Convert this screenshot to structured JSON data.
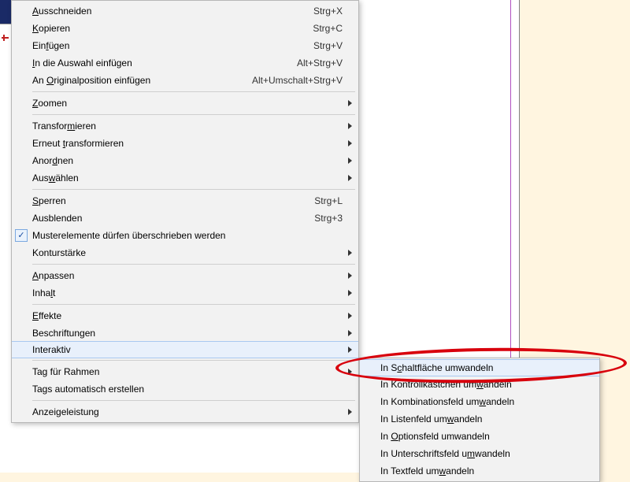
{
  "main_menu": [
    {
      "type": "item",
      "label": "Ausschneiden",
      "underline": 0,
      "shortcut": "Strg+X"
    },
    {
      "type": "item",
      "label": "Kopieren",
      "underline": 0,
      "shortcut": "Strg+C"
    },
    {
      "type": "item",
      "label": "Einfügen",
      "underline": 3,
      "shortcut": "Strg+V"
    },
    {
      "type": "item",
      "label": "In die Auswahl einfügen",
      "underline": 0,
      "shortcut": "Alt+Strg+V"
    },
    {
      "type": "item",
      "label": "An Originalposition einfügen",
      "underline": 3,
      "shortcut": "Alt+Umschalt+Strg+V"
    },
    {
      "type": "sep"
    },
    {
      "type": "item",
      "label": "Zoomen",
      "underline": 0,
      "submenu": true
    },
    {
      "type": "sep"
    },
    {
      "type": "item",
      "label": "Transformieren",
      "underline": 8,
      "submenu": true
    },
    {
      "type": "item",
      "label": "Erneut transformieren",
      "underline": 7,
      "submenu": true
    },
    {
      "type": "item",
      "label": "Anordnen",
      "underline": 4,
      "submenu": true
    },
    {
      "type": "item",
      "label": "Auswählen",
      "underline": 3,
      "submenu": true
    },
    {
      "type": "sep"
    },
    {
      "type": "item",
      "label": "Sperren",
      "underline": 0,
      "shortcut": "Strg+L"
    },
    {
      "type": "item",
      "label": "Ausblenden",
      "underline": -1,
      "shortcut": "Strg+3"
    },
    {
      "type": "item",
      "label": "Musterelemente dürfen überschrieben werden",
      "underline": -1,
      "checked": true
    },
    {
      "type": "item",
      "label": "Konturstärke",
      "underline": -1,
      "submenu": true
    },
    {
      "type": "sep"
    },
    {
      "type": "item",
      "label": "Anpassen",
      "underline": 0,
      "submenu": true
    },
    {
      "type": "item",
      "label": "Inhalt",
      "underline": 4,
      "submenu": true
    },
    {
      "type": "sep"
    },
    {
      "type": "item",
      "label": "Effekte",
      "underline": 0,
      "submenu": true
    },
    {
      "type": "item",
      "label": "Beschriftungen",
      "underline": -1,
      "submenu": true
    },
    {
      "type": "item",
      "label": "Interaktiv",
      "underline": -1,
      "submenu": true,
      "hover": true
    },
    {
      "type": "sep"
    },
    {
      "type": "item",
      "label": "Tag für Rahmen",
      "underline": -1,
      "submenu": true
    },
    {
      "type": "item",
      "label": "Tags automatisch erstellen",
      "underline": -1
    },
    {
      "type": "sep"
    },
    {
      "type": "item",
      "label": "Anzeigeleistung",
      "underline": -1,
      "submenu": true
    }
  ],
  "sub_menu": [
    {
      "label": "In Schaltfläche umwandeln",
      "underline": 4,
      "hover": true
    },
    {
      "label": "In Kontrollkästchen umwandeln",
      "underline": 22
    },
    {
      "label": "In Kombinationsfeld umwandeln",
      "underline": 22
    },
    {
      "label": "In Listenfeld umwandeln",
      "underline": 16
    },
    {
      "label": "In Optionsfeld umwandeln",
      "underline": 3
    },
    {
      "label": "In Unterschriftsfeld umwandeln",
      "underline": 22
    },
    {
      "label": "In Textfeld umwandeln",
      "underline": 14
    }
  ]
}
